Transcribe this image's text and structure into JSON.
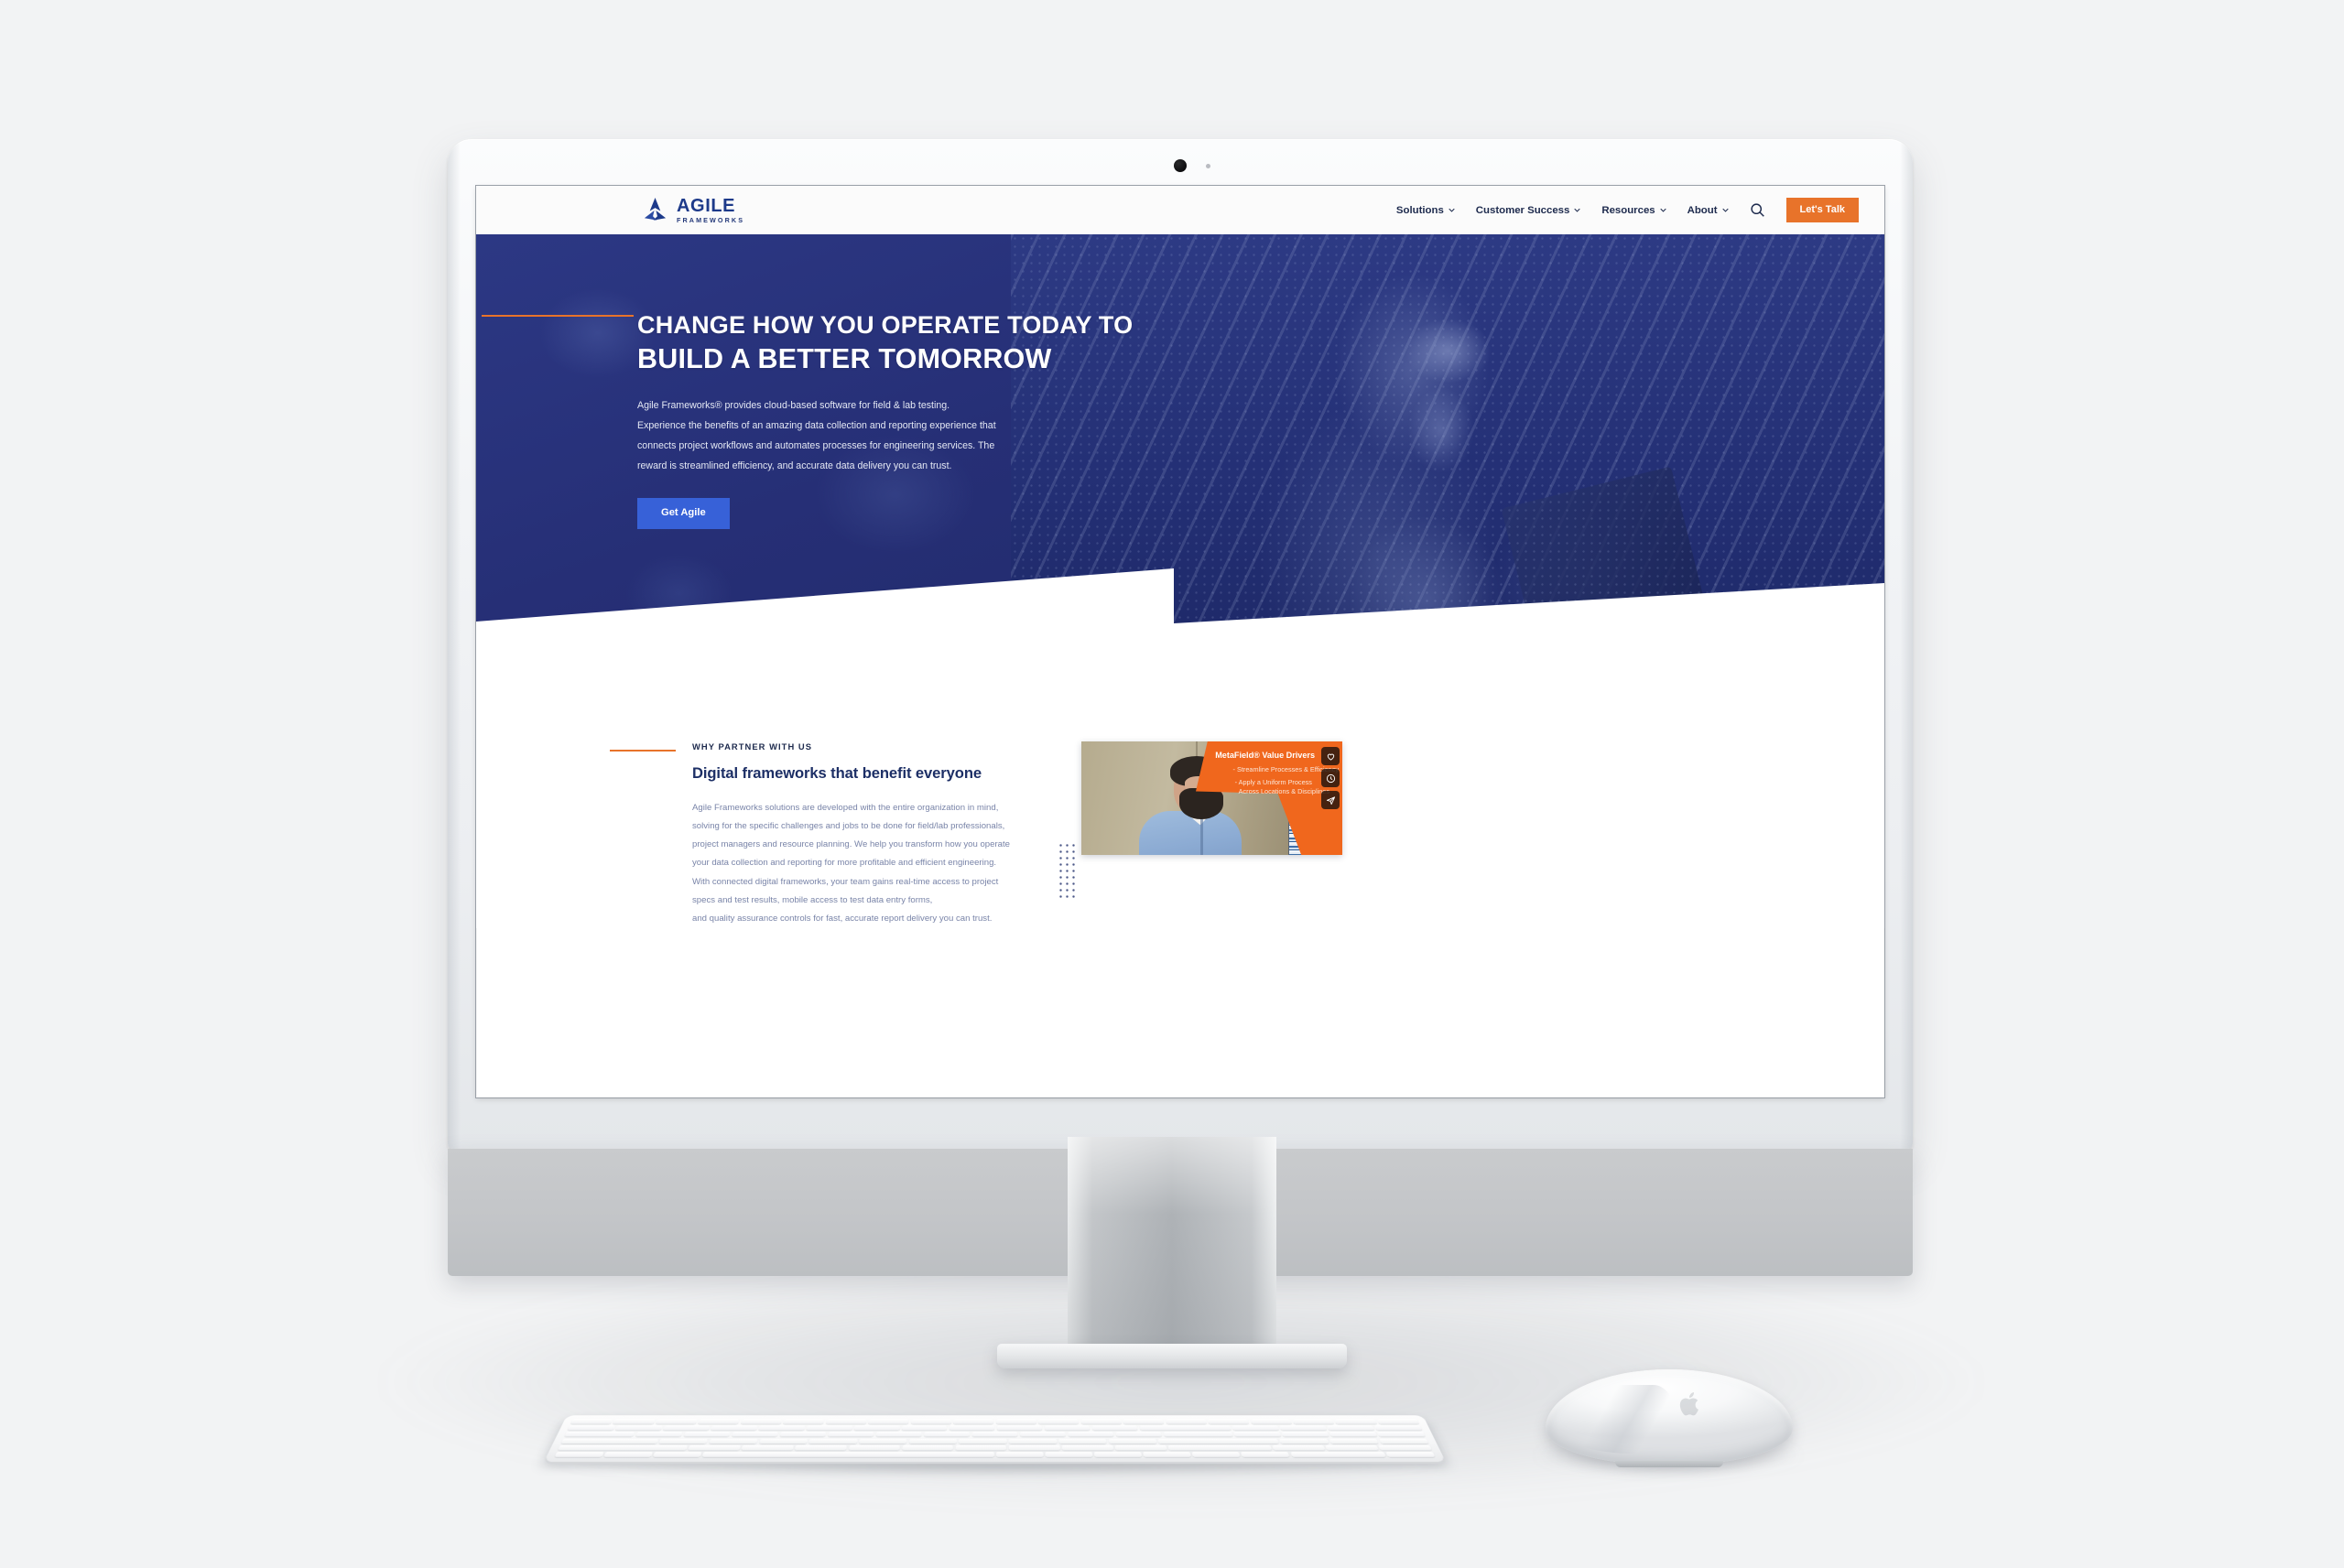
{
  "device": {
    "type": "desktop-computer-mockup",
    "bezel_color": "#eef0f2",
    "chin_color": "#c5c8cb",
    "peripherals": [
      "keyboard",
      "mouse"
    ]
  },
  "site": {
    "logo": {
      "icon": "agile-trillium-logo-icon",
      "word": "AGILE",
      "subword": "FRAMEWORKS",
      "color": "#1d3a8a"
    },
    "nav": {
      "items": [
        {
          "label": "Solutions",
          "has_dropdown": true
        },
        {
          "label": "Customer Success",
          "has_dropdown": true
        },
        {
          "label": "Resources",
          "has_dropdown": true
        },
        {
          "label": "About",
          "has_dropdown": true
        }
      ],
      "search_icon": "search-icon",
      "cta_label": "Let's Talk",
      "cta_color": "#e8732a"
    },
    "hero": {
      "headline_line1": "CHANGE HOW YOU OPERATE TODAY TO",
      "headline_line2": "BUILD A BETTER TOMORROW",
      "paragraph": "Agile Frameworks® provides cloud-based software for field & lab testing. Experience the benefits of an amazing data collection and reporting experience that connects project workflows and automates processes for engineering services. The reward is streamlined efficiency, and accurate data delivery you can trust.",
      "button_label": "Get Agile",
      "button_color": "#3761d8",
      "background_color": "#26327a",
      "accent_color": "#e8732a",
      "image_alt": "construction worker in hard hat holding a tablet"
    },
    "partner": {
      "eyebrow": "WHY PARTNER WITH US",
      "heading": "Digital frameworks that benefit everyone",
      "paragraph_lines": [
        "Agile Frameworks solutions are developed with the entire organization in mind,",
        "solving for the specific challenges and jobs to be done for field/lab professionals,",
        "project managers and resource planning. We help you transform how you operate",
        "your data collection and reporting for more profitable and efficient engineering.",
        "With connected digital frameworks, your team gains real-time access to project",
        "specs and test results, mobile access to test data entry forms,",
        "and quality assurance controls for fast, accurate report delivery you can trust."
      ],
      "heading_color": "#1d2f66",
      "video": {
        "overlay_title": "MetaField® Value Drivers",
        "overlay_bullet_1": "- Streamline Processes & Efficiency",
        "overlay_bullet_2": "- Apply a Uniform Process\nAcross Locations & Disciplines",
        "overlay_color": "#f0671d",
        "thumbnail_alt": "bearded man in light blue shirt presenting to camera",
        "actions": [
          {
            "icon": "heart-icon",
            "name": "like"
          },
          {
            "icon": "clock-icon",
            "name": "watch-later"
          },
          {
            "icon": "send-icon",
            "name": "share"
          }
        ]
      }
    }
  }
}
